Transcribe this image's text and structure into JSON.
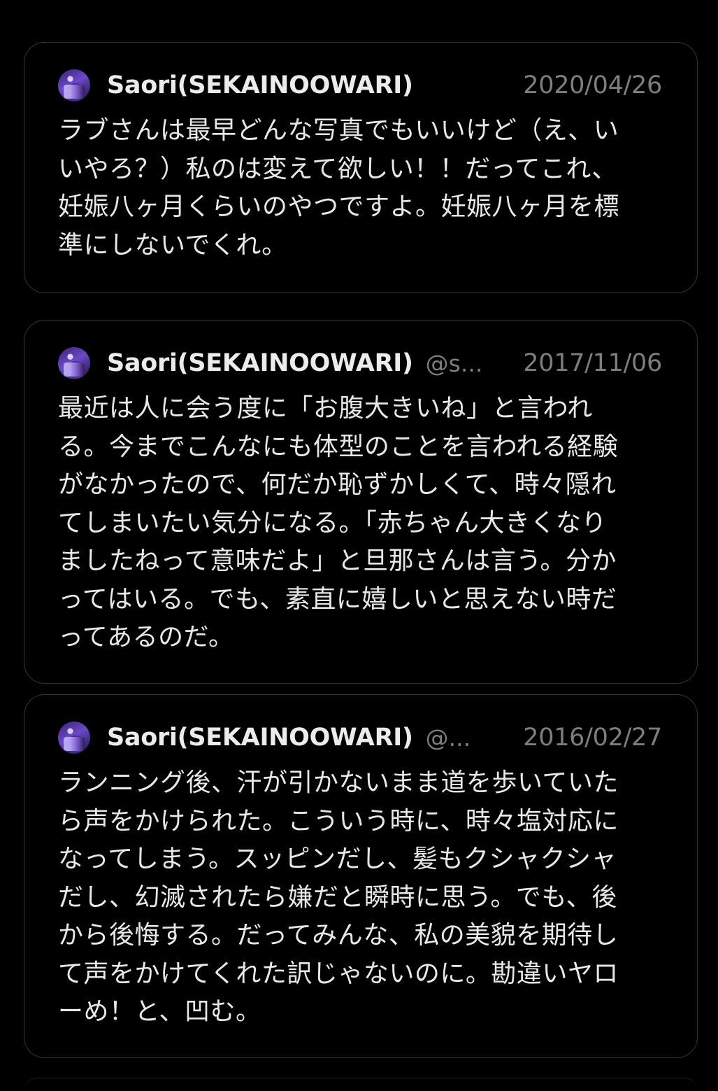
{
  "posts": [
    {
      "display_name": "Saori(SEKAINOOWARI)",
      "handle": "",
      "date": "2020/04/26",
      "text": "ラブさんは最早どんな写真でもいいけど（え、い\nいやろ？）私のは変えて欲しい！！だってこれ、\n妊娠八ヶ月くらいのやつですよ。妊娠八ヶ月を標\n準にしないでくれ。"
    },
    {
      "display_name": "Saori(SEKAINOOWARI)",
      "handle": "@s...",
      "date": "2017/11/06",
      "text": "最近は人に会う度に「お腹大きいね」と言われ\nる。今までこんなにも体型のことを言われる経験\nがなかったので、何だか恥ずかしくて、時々隠れ\nてしまいたい気分になる。「赤ちゃん大きくなり\nましたねって意味だよ」と旦那さんは言う。分か\nってはいる。でも、素直に嬉しいと思えない時だ\nってあるのだ。"
    },
    {
      "display_name": "Saori(SEKAINOOWARI)",
      "handle": "@...",
      "date": "2016/02/27",
      "text": "ランニング後、汗が引かないまま道を歩いていた\nら声をかけられた。こういう時に、時々塩対応に\nなってしまう。スッピンだし、髪もクシャクシャ\nだし、幻滅されたら嫌だと瞬時に思う。でも、後\nから後悔する。だってみんな、私の美貌を期待し\nて声をかけてくれた訳じゃないのに。勘違いヤロ\nーめ！と、凹む。"
    }
  ],
  "colors": {
    "background": "#000000",
    "card_border": "#333336",
    "primary_text": "#e8e8e8",
    "secondary_text": "#7d7d82"
  }
}
